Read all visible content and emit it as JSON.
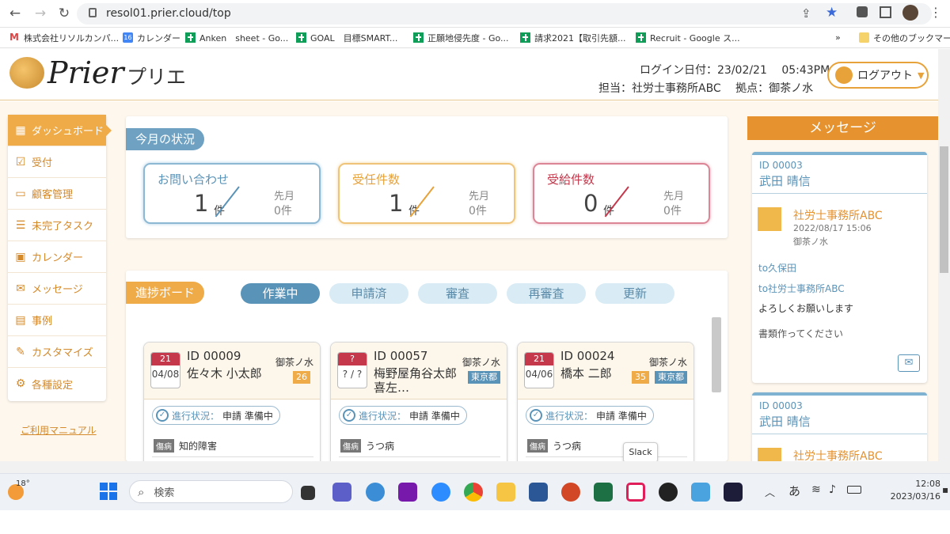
{
  "browser": {
    "url": "resol01.prier.cloud/top",
    "bookmarks": [
      {
        "label": "株式会社リソルカンパ...",
        "icon": "gmail-icon"
      },
      {
        "label": "カレンダー",
        "icon": "calendar-icon"
      },
      {
        "label": "Anken　sheet - Go...",
        "icon": "sheets-icon"
      },
      {
        "label": "GOAL　目標SMART...",
        "icon": "sheets-icon"
      },
      {
        "label": "正願地侵先度 - Go...",
        "icon": "sheets-icon"
      },
      {
        "label": "請求2021【取引先額...",
        "icon": "sheets-icon"
      },
      {
        "label": "Recruit - Google ス...",
        "icon": "sheets-icon"
      }
    ],
    "bookmarks_more": "»",
    "other_bookmarks": "その他のブックマーク"
  },
  "header": {
    "logo": "Prier",
    "app_name": "プリエ",
    "login_info": "ログイン日付：23/02/21　 05:43PM",
    "staff_info": "担当：社労士事務所ABC　 拠点：御茶ノ水",
    "logout": "ログアウト"
  },
  "sidebar": {
    "items": [
      {
        "label": "ダッシュボード",
        "icon": "dashboard-icon",
        "active": true
      },
      {
        "label": "受付",
        "icon": "clipboard-icon"
      },
      {
        "label": "顧客管理",
        "icon": "folder-icon"
      },
      {
        "label": "未完了タスク",
        "icon": "task-list-icon"
      },
      {
        "label": "カレンダー",
        "icon": "calendar-icon"
      },
      {
        "label": "メッセージ",
        "icon": "envelope-icon"
      },
      {
        "label": "事例",
        "icon": "document-icon"
      },
      {
        "label": "カスタマイズ",
        "icon": "wrench-icon"
      },
      {
        "label": "各種設定",
        "icon": "gear-icon"
      }
    ],
    "manual": "ご利用マニュアル"
  },
  "status": {
    "title": "今月の状況",
    "cards": [
      {
        "title": "お問い合わせ",
        "count": "1",
        "unit": "件",
        "prev_label": "先月",
        "prev_value": "0件",
        "color": "#5a93b8"
      },
      {
        "title": "受任件数",
        "count": "1",
        "unit": "件",
        "prev_label": "先月",
        "prev_value": "0件",
        "color": "#e8a23a"
      },
      {
        "title": "受給件数",
        "count": "0",
        "unit": "件",
        "prev_label": "先月",
        "prev_value": "0件",
        "color": "#c5384c"
      }
    ]
  },
  "progress": {
    "title": "進捗ボード",
    "tabs": [
      "作業中",
      "申請済",
      "審査",
      "再審査",
      "更新"
    ],
    "cards": [
      {
        "day": "21",
        "month": "04",
        "date": "08",
        "id": "ID 00009",
        "name": "佐々木 小太郎",
        "office": "御茶ノ水",
        "age": "26",
        "location": "",
        "status_label": "進行状況：",
        "status": "申請 準備中",
        "illness_tag": "傷病",
        "illness": "知的障害"
      },
      {
        "day": "?",
        "month": "?",
        "date": "?",
        "id": "ID 00057",
        "name": "梅野屋角谷太郎喜左…",
        "office": "御茶ノ水",
        "age": "",
        "location": "東京都",
        "status_label": "進行状況：",
        "status": "申請 準備中",
        "illness_tag": "傷病",
        "illness": "うつ病"
      },
      {
        "day": "21",
        "month": "04",
        "date": "06",
        "id": "ID 00024",
        "name": "橋本 二郎",
        "office": "御茶ノ水",
        "age": "35",
        "location": "東京都",
        "status_label": "進行状況：",
        "status": "申請 準備中",
        "illness_tag": "傷病",
        "illness": "うつ病"
      }
    ]
  },
  "messages": {
    "title": "メッセージ",
    "items": [
      {
        "id": "ID 00003",
        "name": "武田 晴信",
        "sender": "社労士事務所ABC",
        "time": "2022/08/17 15:06",
        "branch": "御茶ノ水",
        "to1": "to久保田",
        "to2": "to社労士事務所ABC",
        "line1": "よろしくお願いします",
        "line2": "書類作ってください"
      },
      {
        "id": "ID 00003",
        "name": "武田 晴信",
        "sender": "社労士事務所ABC"
      }
    ]
  },
  "taskbar": {
    "weather": "18°",
    "search": "検索",
    "tooltip": "Slack",
    "ime": "あ",
    "time": "12:08",
    "date": "2023/03/16"
  }
}
